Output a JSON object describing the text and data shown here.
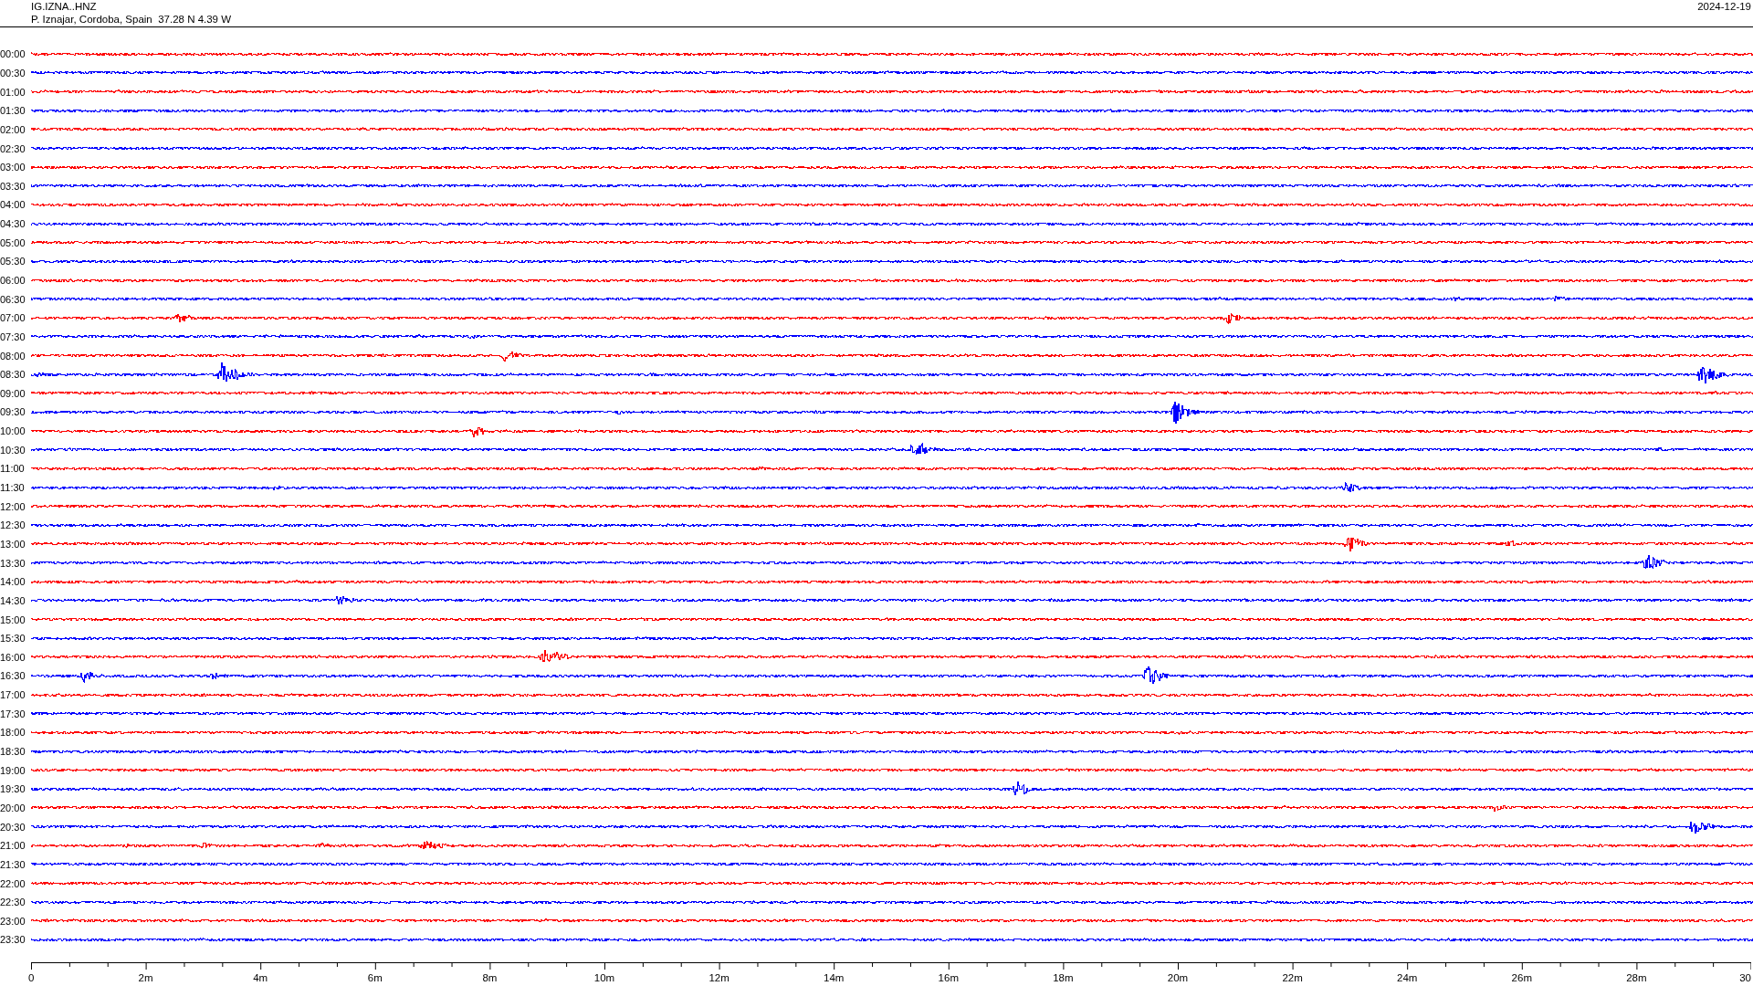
{
  "header": {
    "station": "IG.IZNA..HNZ",
    "location": "P. Iznajar, Cordoba, Spain  37.28 N 4.39 W",
    "date": "2024-12-19"
  },
  "traces": [
    {
      "time": "00:00",
      "color": "#ff0000"
    },
    {
      "time": "00:30",
      "color": "#0000ff"
    },
    {
      "time": "01:00",
      "color": "#ff0000"
    },
    {
      "time": "01:30",
      "color": "#0000ff"
    },
    {
      "time": "02:00",
      "color": "#ff0000"
    },
    {
      "time": "02:30",
      "color": "#0000ff"
    },
    {
      "time": "03:00",
      "color": "#ff0000"
    },
    {
      "time": "03:30",
      "color": "#0000ff"
    },
    {
      "time": "04:00",
      "color": "#ff0000"
    },
    {
      "time": "04:30",
      "color": "#0000ff"
    },
    {
      "time": "05:00",
      "color": "#ff0000"
    },
    {
      "time": "05:30",
      "color": "#0000ff"
    },
    {
      "time": "06:00",
      "color": "#ff0000"
    },
    {
      "time": "06:30",
      "color": "#0000ff"
    },
    {
      "time": "07:00",
      "color": "#ff0000"
    },
    {
      "time": "07:30",
      "color": "#0000ff"
    },
    {
      "time": "08:00",
      "color": "#ff0000"
    },
    {
      "time": "08:30",
      "color": "#0000ff"
    },
    {
      "time": "09:00",
      "color": "#ff0000"
    },
    {
      "time": "09:30",
      "color": "#0000ff"
    },
    {
      "time": "10:00",
      "color": "#ff0000"
    },
    {
      "time": "10:30",
      "color": "#0000ff"
    },
    {
      "time": "11:00",
      "color": "#ff0000"
    },
    {
      "time": "11:30",
      "color": "#0000ff"
    },
    {
      "time": "12:00",
      "color": "#ff0000"
    },
    {
      "time": "12:30",
      "color": "#0000ff"
    },
    {
      "time": "13:00",
      "color": "#ff0000"
    },
    {
      "time": "13:30",
      "color": "#0000ff"
    },
    {
      "time": "14:00",
      "color": "#ff0000"
    },
    {
      "time": "14:30",
      "color": "#0000ff"
    },
    {
      "time": "15:00",
      "color": "#ff0000"
    },
    {
      "time": "15:30",
      "color": "#0000ff"
    },
    {
      "time": "16:00",
      "color": "#ff0000"
    },
    {
      "time": "16:30",
      "color": "#0000ff"
    },
    {
      "time": "17:00",
      "color": "#ff0000"
    },
    {
      "time": "17:30",
      "color": "#0000ff"
    },
    {
      "time": "18:00",
      "color": "#ff0000"
    },
    {
      "time": "18:30",
      "color": "#0000ff"
    },
    {
      "time": "19:00",
      "color": "#ff0000"
    },
    {
      "time": "19:30",
      "color": "#0000ff"
    },
    {
      "time": "20:00",
      "color": "#ff0000"
    },
    {
      "time": "20:30",
      "color": "#0000ff"
    },
    {
      "time": "21:00",
      "color": "#ff0000"
    },
    {
      "time": "21:30",
      "color": "#0000ff"
    },
    {
      "time": "22:00",
      "color": "#ff0000"
    },
    {
      "time": "22:30",
      "color": "#0000ff"
    },
    {
      "time": "23:00",
      "color": "#ff0000"
    },
    {
      "time": "23:30",
      "color": "#0000ff"
    }
  ],
  "x_axis": {
    "labels": [
      "0",
      "2m",
      "4m",
      "6m",
      "8m",
      "10m",
      "12m",
      "14m",
      "16m",
      "18m",
      "20m",
      "22m",
      "24m",
      "26m",
      "28m",
      "30"
    ]
  }
}
